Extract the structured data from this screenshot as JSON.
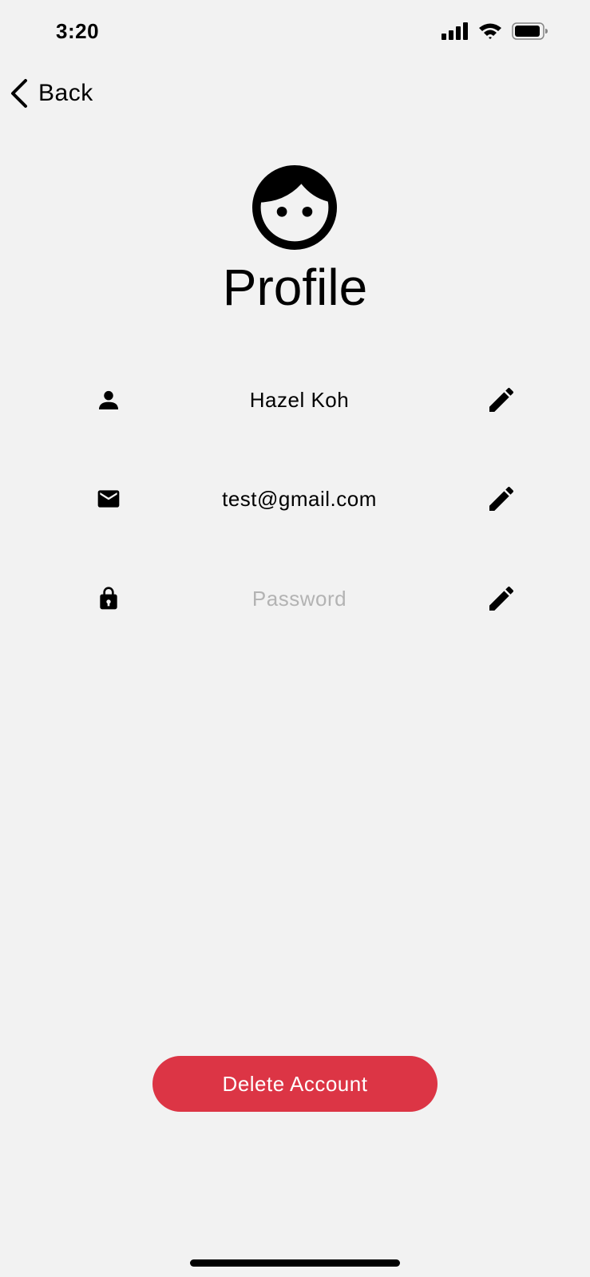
{
  "status_bar": {
    "time": "3:20",
    "signal_icon": "cellular-signal-icon",
    "wifi_icon": "wifi-icon",
    "battery_icon": "battery-icon"
  },
  "nav": {
    "back_label": "Back",
    "back_icon": "chevron-left-icon"
  },
  "header": {
    "avatar_icon": "face-icon",
    "title": "Profile"
  },
  "fields": [
    {
      "icon": "person-icon",
      "value": "Hazel Koh",
      "edit_icon": "pencil-icon"
    },
    {
      "icon": "mail-icon",
      "value": "test@gmail.com",
      "edit_icon": "pencil-icon"
    },
    {
      "icon": "lock-icon",
      "placeholder": "Password",
      "edit_icon": "pencil-icon"
    }
  ],
  "actions": {
    "delete_label": "Delete Account"
  },
  "colors": {
    "background": "#f2f2f2",
    "danger": "#dc3545",
    "placeholder": "#b3b3b3"
  }
}
